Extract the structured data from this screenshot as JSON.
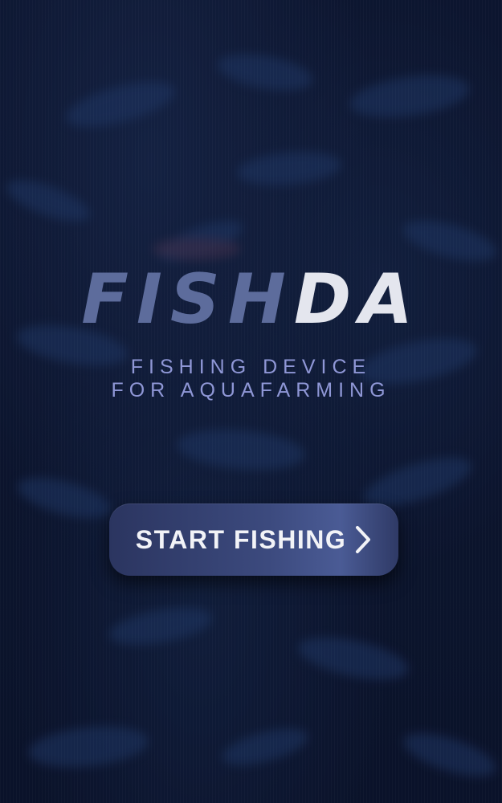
{
  "brand": {
    "logo_part_a": "FISH",
    "logo_part_b": "DA",
    "tagline_line1": "FISHING DEVICE",
    "tagline_line2": "FOR AQUAFARMING"
  },
  "cta": {
    "label": "START FISHING",
    "icon": "chevron-right-icon"
  },
  "colors": {
    "background": "#0e1936",
    "logo_part_a": "#5d6c9c",
    "logo_part_b": "#e4e6ee",
    "tagline": "#8f97d6",
    "button": "#3c4a7e",
    "button_text": "#f2f3f7"
  },
  "background_image": "blurred-fish-school"
}
